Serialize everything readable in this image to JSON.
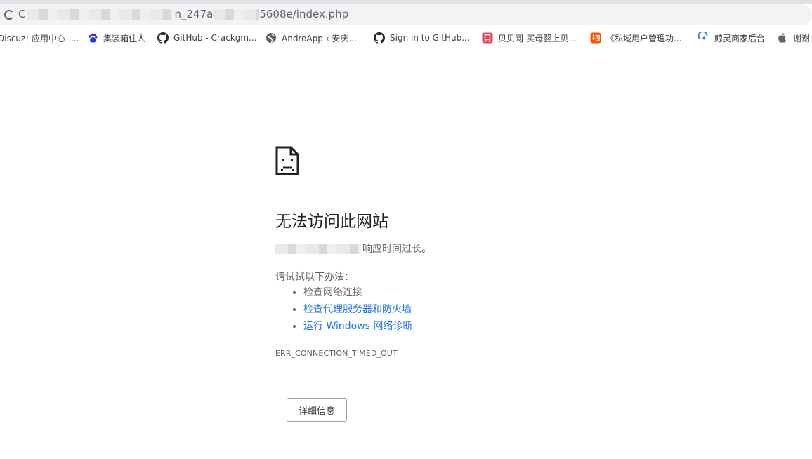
{
  "browser": {
    "url_visible_1": "C",
    "url_visible_2": "n_247a",
    "url_visible_3": "5608e/index.php"
  },
  "bookmarks": [
    {
      "label": "Discuz! 应用中心 -...",
      "icon": "discuz-icon"
    },
    {
      "label": "集装箱住人",
      "icon": "baidu-paw-icon"
    },
    {
      "label": "GitHub - Crackgm...",
      "icon": "github-icon"
    },
    {
      "label": "AndroApp ‹ 安庆...",
      "icon": "globe-icon"
    },
    {
      "label": "Sign in to GitHub...",
      "icon": "github-icon"
    },
    {
      "label": "贝贝网-买母婴上贝...",
      "icon": "beibei-icon"
    },
    {
      "label": "《私域用户管理功...",
      "icon": "taobao-icon"
    },
    {
      "label": "鲸灵商家后台",
      "icon": "jingling-icon"
    },
    {
      "label": "谢谢",
      "icon": "apple-icon"
    }
  ],
  "error_page": {
    "title": "无法访问此网站",
    "description_visible": "响应时间过长。",
    "try_heading": "请试试以下办法：",
    "suggestions": [
      "检查网络连接",
      "检查代理服务器和防火墙",
      "运行 Windows 网络诊断"
    ],
    "error_code": "ERR_CONNECTION_TIMED_OUT",
    "details_button": "详细信息"
  },
  "colors": {
    "link": "#1a73e8",
    "text": "#202124",
    "secondary_text": "#5f6368"
  }
}
